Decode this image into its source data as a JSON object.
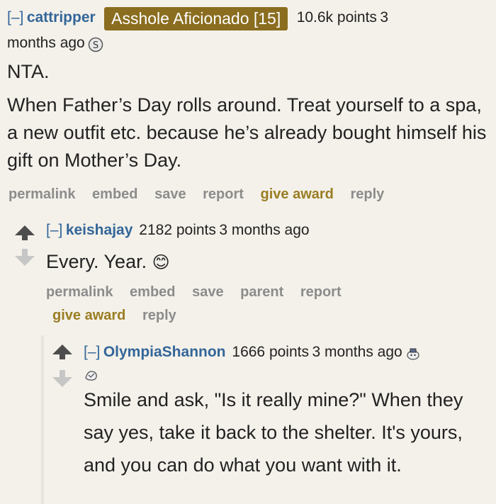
{
  "comments": [
    {
      "toggle": "[–]",
      "author": "cattripper",
      "flair": "Asshole Aficionado [15]",
      "points": "10.6k points",
      "time_first": "3",
      "time_rest": "months ago",
      "body_line1": "NTA.",
      "body_line2": "When Father’s Day rolls around. Treat yourself to a spa, a new outfit etc. because he’s already bought himself his gift on Mother’s Day.",
      "actions": [
        "permalink",
        "embed",
        "save",
        "report",
        "give award",
        "reply"
      ]
    },
    {
      "toggle": "[–]",
      "author": "keishajay",
      "points": "2182 points",
      "time": "3 months ago",
      "body": "Every. Year.",
      "emoji": "😊",
      "actions_row1": [
        "permalink",
        "embed",
        "save",
        "parent",
        "report"
      ],
      "actions_row2": [
        "give award",
        "reply"
      ]
    },
    {
      "toggle": "[–]",
      "author": "OlympiaShannon",
      "points": "1666 points",
      "time": "3 months ago",
      "body": "Smile and ask, \"Is it really mine?\" When they say yes, take it back to the shelter. It's yours, and you can do what you want with it."
    }
  ],
  "colors": {
    "background": "#f4f1ea",
    "link": "#336699",
    "flair_bg": "#8a6d1f",
    "award": "#9a7d22",
    "action": "#8c8c8c"
  }
}
